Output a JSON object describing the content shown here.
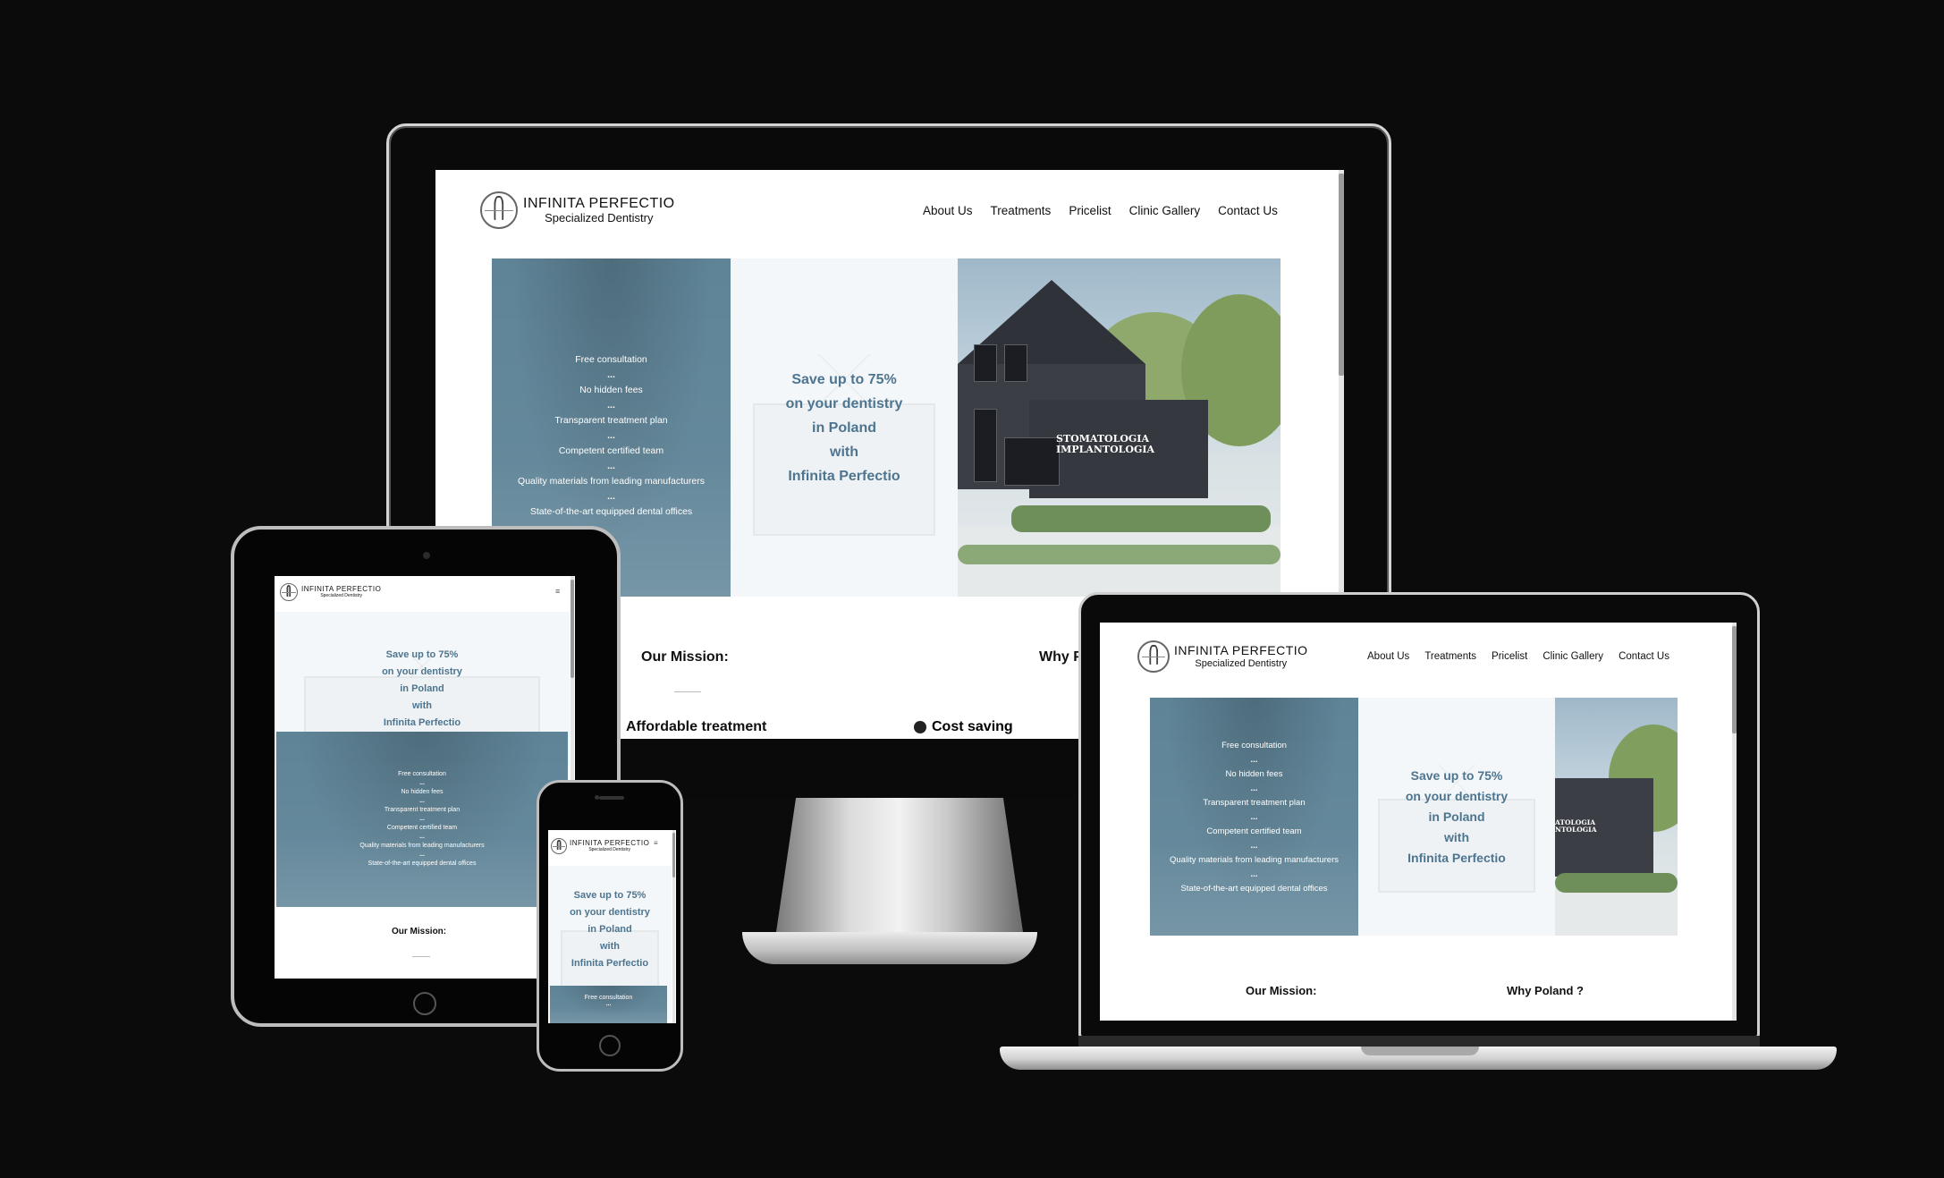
{
  "brand": {
    "name": "INFINITA PERFECTIO",
    "tagline": "Specialized Dentistry"
  },
  "nav": {
    "items": [
      "About Us",
      "Treatments",
      "Pricelist",
      "Clinic Gallery",
      "Contact Us"
    ]
  },
  "hero": {
    "features": [
      "Free consultation",
      "No hidden fees",
      "Transparent treatment plan",
      "Competent certified team",
      "Quality materials from leading manufacturers",
      "State-of-the-art equipped dental offices"
    ],
    "separator": "...",
    "headline": [
      "Save up to 75%",
      "on your dentistry",
      "in Poland",
      "with",
      "Infinita Perfectio"
    ],
    "sign": [
      "STOMATOLOGIA",
      "IMPLANTOLOGIA"
    ],
    "sign_partial": [
      "ATOLOGIA",
      "NTOLOGIA"
    ]
  },
  "sections": {
    "mission": "Our Mission:",
    "why_poland": "Why Poland ?",
    "why_poland_cut": "Why P",
    "affordable": "Affordable treatment",
    "cost_saving": "Cost saving"
  },
  "ui": {
    "menu_icon": "≡",
    "cost_icon": "money-icon"
  },
  "colors": {
    "background": "#0b0b0b",
    "hero_panel": "#587f93",
    "headline": "#4d7590"
  }
}
